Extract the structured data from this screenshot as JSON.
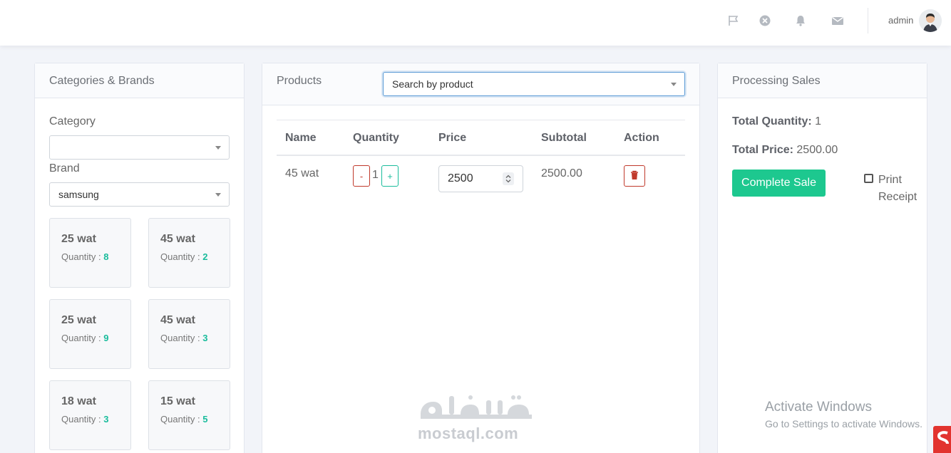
{
  "topbar": {
    "icons": [
      "flag-icon",
      "close-circle-icon",
      "bell-icon",
      "envelope-icon"
    ],
    "user_name": "admin"
  },
  "categories_card": {
    "title": "Categories & Brands",
    "category_label": "Category",
    "category_value": "",
    "brand_label": "Brand",
    "brand_value": "samsung",
    "quantity_prefix": "Quantity : ",
    "products": [
      {
        "name": "25 wat",
        "quantity": "8"
      },
      {
        "name": "45 wat",
        "quantity": "2"
      },
      {
        "name": "25 wat",
        "quantity": "9"
      },
      {
        "name": "45 wat",
        "quantity": "3"
      },
      {
        "name": "18 wat",
        "quantity": "3"
      },
      {
        "name": "15 wat",
        "quantity": "5"
      }
    ]
  },
  "products_card": {
    "title": "Products",
    "search_placeholder": "Search by product",
    "columns": [
      "Name",
      "Quantity",
      "Price",
      "Subtotal",
      "Action"
    ],
    "rows": [
      {
        "name": "45 wat",
        "minus_label": "-",
        "quantity": "1",
        "plus_label": "+",
        "price": "2500",
        "subtotal": "2500.00"
      }
    ]
  },
  "sales_card": {
    "title": "Processing Sales",
    "total_quantity_label": "Total Quantity:",
    "total_quantity": "1",
    "total_price_label": "Total Price:",
    "total_price": "2500.00",
    "complete_label": "Complete Sale",
    "print_receipt_label": "Print Receipt",
    "print_receipt_checked": false
  },
  "watermark": {
    "site": "mostaql.com"
  },
  "os_overlay": {
    "title": "Activate Windows",
    "subtitle": "Go to Settings to activate Windows."
  },
  "colors": {
    "accent_green": "#1dc88f",
    "danger_red": "#c0392b",
    "focus_blue": "#5b9bd5"
  }
}
